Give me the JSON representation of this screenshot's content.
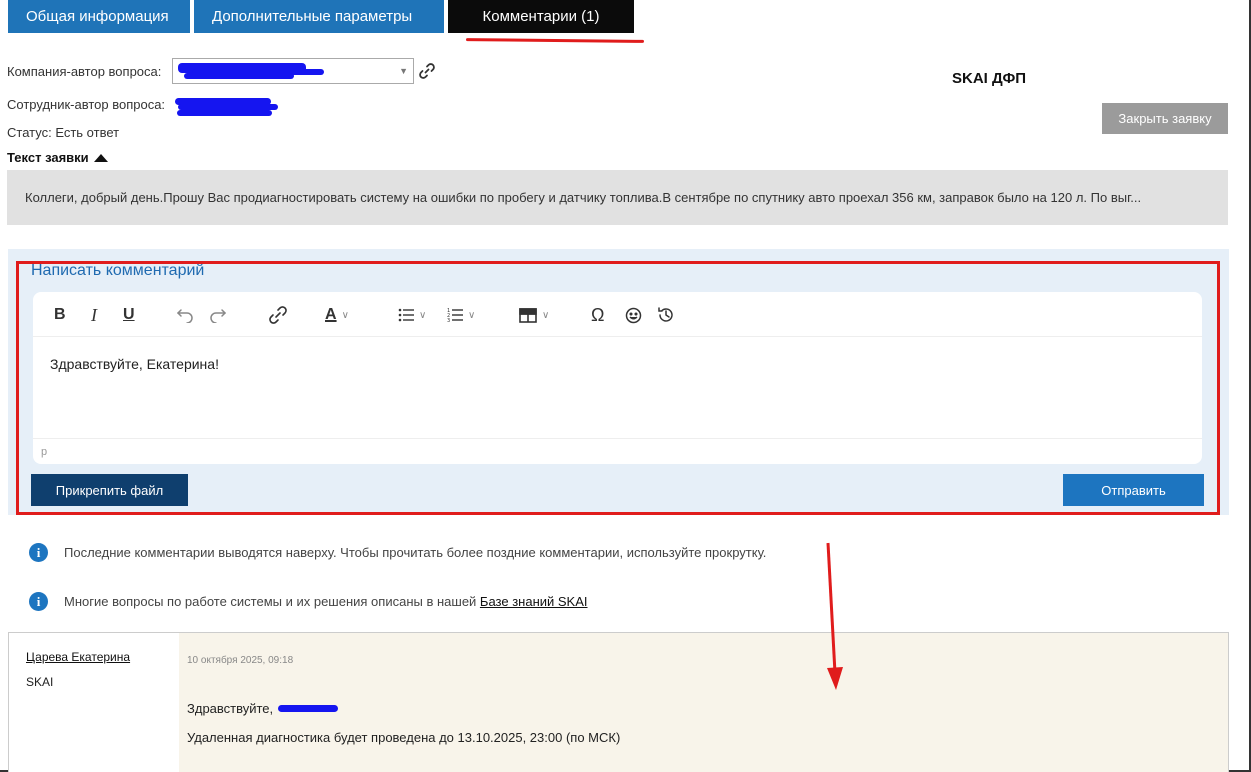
{
  "tabs": [
    {
      "label": "Общая информация"
    },
    {
      "label": "Дополнительные параметры"
    },
    {
      "label": "Комментарии (1)"
    }
  ],
  "fields": {
    "company_label": "Компания-автор вопроса:",
    "employee_label": "Сотрудник-автор вопроса:",
    "status_label": "Статус: Есть ответ"
  },
  "org_title": "SKAI ДФП",
  "close_button": "Закрыть заявку",
  "request": {
    "heading": "Текст заявки",
    "text": "Коллеги, добрый день.Прошу Вас продиагностировать систему на ошибки по пробегу и датчику топлива.В сентябре по спутнику авто проехал 356 км, заправок было на 120 л. По выг..."
  },
  "comment_form": {
    "title": "Написать комментарий",
    "body": "Здравствуйте, Екатерина!",
    "status_path": "p",
    "attach_button": "Прикрепить файл",
    "send_button": "Отправить"
  },
  "notes": {
    "note1": "Последние комментарии выводятся наверху. Чтобы прочитать более поздние комментарии, используйте прокрутку.",
    "note2_prefix": "Многие вопросы по работе системы и их решения описаны в нашей ",
    "note2_link": "Базе знаний SKAI"
  },
  "comment": {
    "author": "Царева Екатерина",
    "org": "SKAI",
    "date": "10 октября 2025, 09:18",
    "greeting": "Здравствуйте, ",
    "text": "Удаленная диагностика будет проведена до 13.10.2025, 23:00 (по МСК)"
  },
  "colors": {
    "tab_blue": "#1f74b8",
    "tab_active": "#0b0b0b",
    "annotation_red": "#e01c1c",
    "redaction_blue": "#1515f0",
    "send_blue": "#1d75c0",
    "attach_navy": "#0f3f6e"
  }
}
